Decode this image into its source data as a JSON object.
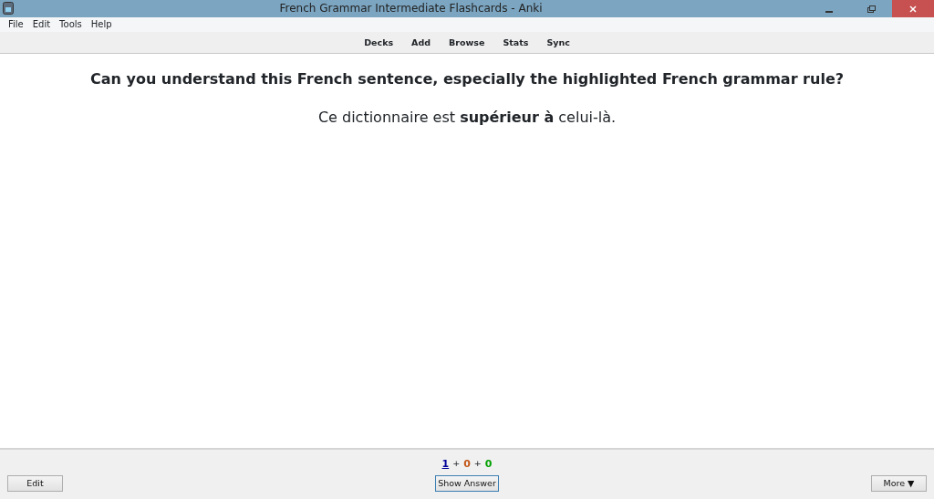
{
  "window": {
    "title": "French Grammar Intermediate Flashcards - Anki"
  },
  "menu": [
    "File",
    "Edit",
    "Tools",
    "Help"
  ],
  "toolbar": [
    "Decks",
    "Add",
    "Browse",
    "Stats",
    "Sync"
  ],
  "card": {
    "question": "Can you understand this French sentence, especially the highlighted French grammar rule?",
    "sentence": "Ce dictionnaire est **supérieur à** celui-là."
  },
  "counts": [
    {
      "value": "1",
      "color": "#000099",
      "current": true
    },
    {
      "value": "0",
      "color": "#c35617",
      "current": false
    },
    {
      "value": "0",
      "color": "#00a000",
      "current": false
    }
  ],
  "count_separators": [
    "+",
    "+"
  ],
  "bottom": {
    "edit": "Edit",
    "show_answer": "Show Answer",
    "more": "More ▼"
  }
}
